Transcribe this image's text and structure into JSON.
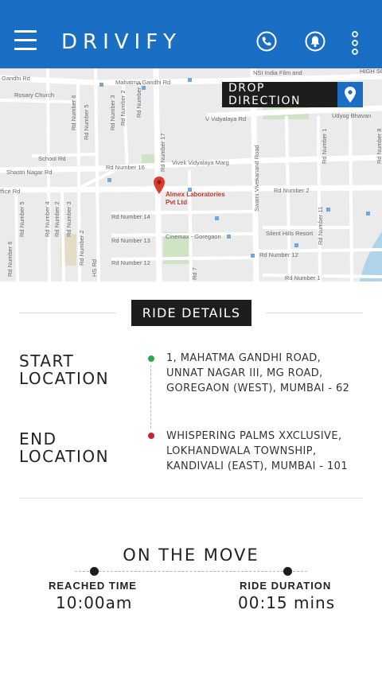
{
  "header": {
    "brand": "DRIVIFY",
    "icons": [
      "menu-icon",
      "phone-icon",
      "bell-icon",
      "more-vertical-icon"
    ]
  },
  "map": {
    "drop_direction_label": "DROP DIRECTION",
    "place": {
      "name_line1": "Almex Laboratories",
      "name_line2": "Pvt Ltd"
    },
    "labels": {
      "gandhi_rd": "Gandhi Rd",
      "mahatma_gandhi_rd": "Mahatma Gandhi Rd",
      "rosary_church": "Rosary Church",
      "nsi_india": "NSI India Film and",
      "tv": "TV Editing Institute",
      "high_sc": "HIGH SC",
      "udyog_bhavan": "Udyog Bhavan",
      "vidyalaya_rd": "V Vidyalaya Rd",
      "school_rd": "School Rd",
      "shastri_nagar_rd": "Shastri Nagar Rd",
      "office_rd": "ffice Rd",
      "rd16": "Rd Number 16",
      "vivek_vidyalaya_marg": "Vivek Vidyalaya Marg",
      "rd14": "Rd Number 14",
      "rd13": "Rd Number 13",
      "rd12_left": "Rd Number 12",
      "rd2_right": "Rd Number 2",
      "rd12_right": "Rd Number 12",
      "rd1_bottom": "Rd Number 1",
      "cinemax": "Cinemax - Goregaon",
      "silent_hills": "Silent Hills Resort",
      "rd_number_5": "Rd Number 5",
      "rd_number_6": "Rd Number 6",
      "rd_number_3": "Rd Number 3",
      "rd_number_2": "Rd Number 2",
      "rd_number_1": "Rd Number 1",
      "rd_number_17": "Rd Number 17",
      "rd_number_4": "Rd Number 4",
      "rd_number_11": "Rd Number 11",
      "rd_number_8": "Rd Number 8",
      "swami_vivekanand_rd": "Swami Vivekanand Road",
      "vert_hs": "HS Rd",
      "vert_rd7": "Rd 7",
      "vert_rd_number_1_right": "Rd Number 1",
      "vert_rd_number_2_small": "Rd Number 2",
      "rd_number_8_top": "Rd Number 8"
    }
  },
  "ride_details": {
    "title": "RIDE DETAILS",
    "start": {
      "title_line1": "START",
      "title_line2": "LOCATION",
      "address_line1": "1, MAHATMA GANDHI ROAD,",
      "address_line2": "UNNAT NAGAR III, MG ROAD,",
      "address_line3": "GOREGAON (WEST), MUMBAI - 62"
    },
    "end": {
      "title_line1": "END",
      "title_line2": "LOCATION",
      "address_line1": "WHISPERING PALMS XXCLUSIVE,",
      "address_line2": "LOKHANDWALA TOWNSHIP,",
      "address_line3": "KANDIVALI (EAST), MUMBAI - 101"
    }
  },
  "status": {
    "title": "ON THE MOVE",
    "reached_time_label": "REACHED TIME",
    "reached_time_value": "10:00am",
    "ride_duration_label": "RIDE DURATION",
    "ride_duration_value": "00:15 mins"
  },
  "colors": {
    "brand_blue": "#1a6fc4",
    "dark": "#1d1d1d",
    "start_green": "#2aa84a",
    "end_red": "#c0282e"
  }
}
